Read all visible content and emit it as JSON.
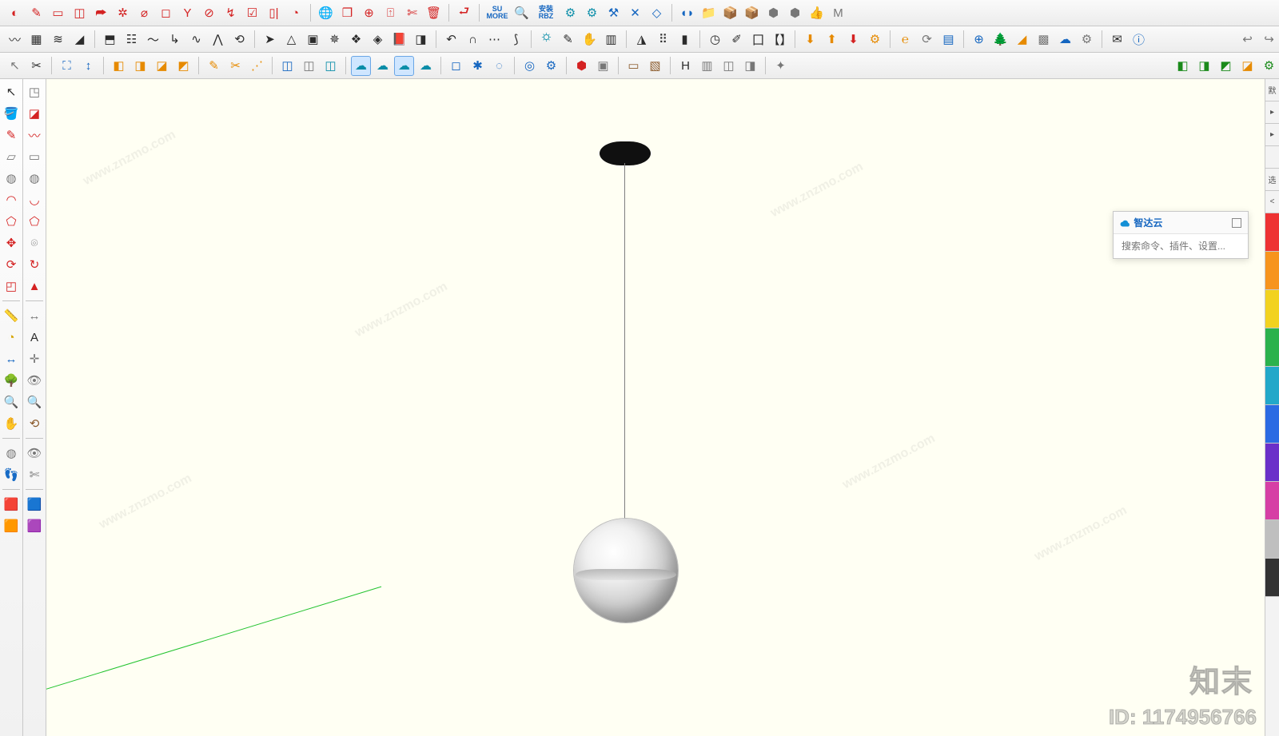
{
  "app": "SketchUp",
  "float_panel": {
    "title": "智达云",
    "search_placeholder": "搜索命令、插件、设置..."
  },
  "watermark": {
    "brand": "知末",
    "url": "www.znzmo.com",
    "id_label": "ID: 1174956766"
  },
  "toolbar_rows": [
    [
      {
        "n": "sweep-icon",
        "g": "◐",
        "c": "red"
      },
      {
        "n": "edit-icon",
        "g": "✎",
        "c": "red"
      },
      {
        "n": "window-icon",
        "g": "▭",
        "c": "red"
      },
      {
        "n": "rotate-box-icon",
        "g": "◫",
        "c": "red"
      },
      {
        "n": "export-icon",
        "g": "⮫",
        "c": "red"
      },
      {
        "n": "gear-wheel-icon",
        "g": "✲",
        "c": "red"
      },
      {
        "n": "cylinder-icon",
        "g": "⌀",
        "c": "red"
      },
      {
        "n": "cube-icon",
        "g": "◻",
        "c": "red"
      },
      {
        "n": "wine-icon",
        "g": "Y",
        "c": "red"
      },
      {
        "n": "cancel-icon",
        "g": "⊘",
        "c": "red"
      },
      {
        "n": "path-icon",
        "g": "↯",
        "c": "red"
      },
      {
        "n": "check-icon",
        "g": "☑",
        "c": "red"
      },
      {
        "n": "bar-bracket-icon",
        "g": "▯|",
        "c": "red"
      },
      {
        "n": "lasso-icon",
        "g": "◔",
        "c": "red"
      },
      {
        "sep": true
      },
      {
        "n": "globe-wire-icon",
        "g": "🌐",
        "c": "red"
      },
      {
        "n": "cube3d-icon",
        "g": "❒",
        "c": "red"
      },
      {
        "n": "target-icon",
        "g": "⊕",
        "c": "red"
      },
      {
        "n": "arrow-up-box-icon",
        "g": "⍐",
        "c": "red"
      },
      {
        "n": "cut-alt-icon",
        "g": "✄",
        "c": "red"
      },
      {
        "n": "trash-icon",
        "g": "🗑",
        "c": "red"
      },
      {
        "sep": true
      },
      {
        "n": "enter-icon",
        "g": "⮐",
        "c": "red"
      },
      {
        "sep": true
      },
      {
        "n": "su-more-text",
        "text": "SU\nMORE"
      },
      {
        "n": "search-icon",
        "g": "🔍",
        "c": "blue"
      },
      {
        "n": "install-rbz-text",
        "text": "安装\nRBZ"
      },
      {
        "n": "gear1-icon",
        "g": "⚙",
        "c": "teal"
      },
      {
        "n": "gear2-icon",
        "g": "⚙",
        "c": "teal"
      },
      {
        "n": "tools-icon",
        "g": "⚒",
        "c": "blue"
      },
      {
        "n": "tools2-icon",
        "g": "✕",
        "c": "blue"
      },
      {
        "n": "transform-icon",
        "g": "◇",
        "c": "blue"
      },
      {
        "sep": true
      },
      {
        "n": "toggle-icon",
        "g": "◖◗",
        "c": "blue"
      },
      {
        "n": "folder-icon",
        "g": "📁",
        "c": "blue"
      },
      {
        "n": "package1-icon",
        "g": "📦",
        "c": "gray"
      },
      {
        "n": "package2-icon",
        "g": "📦",
        "c": "gray"
      },
      {
        "n": "package3-icon",
        "g": "⬢",
        "c": "gray"
      },
      {
        "n": "package4-icon",
        "g": "⬢",
        "c": "gray"
      },
      {
        "n": "thumbs-icon",
        "g": "👍",
        "c": "gray"
      },
      {
        "n": "m-icon",
        "g": "M",
        "c": "gray"
      }
    ],
    [
      {
        "n": "curve-tool-icon",
        "g": "〰",
        "c": "black"
      },
      {
        "n": "grid-icon",
        "g": "▦",
        "c": "black"
      },
      {
        "n": "layers-icon",
        "g": "≋",
        "c": "black"
      },
      {
        "n": "signal-icon",
        "g": "◢",
        "c": "black"
      },
      {
        "sep": true
      },
      {
        "n": "shape1-icon",
        "g": "⬒",
        "c": "black"
      },
      {
        "n": "shape2-icon",
        "g": "☷",
        "c": "black"
      },
      {
        "n": "curve2-icon",
        "g": "〜",
        "c": "black"
      },
      {
        "n": "anchor-icon",
        "g": "↳",
        "c": "black"
      },
      {
        "n": "wave-icon",
        "g": "∿",
        "c": "black"
      },
      {
        "n": "bracket-icon",
        "g": "⋀",
        "c": "black"
      },
      {
        "n": "outline-icon",
        "g": "⟲",
        "c": "black"
      },
      {
        "sep": true
      },
      {
        "n": "nav-arrow-icon",
        "g": "➤",
        "c": "black"
      },
      {
        "n": "topo-icon",
        "g": "△",
        "c": "black"
      },
      {
        "n": "box-icon",
        "g": "▣",
        "c": "black"
      },
      {
        "n": "spray-icon",
        "g": "✵",
        "c": "black"
      },
      {
        "n": "stack-icon",
        "g": "❖",
        "c": "black"
      },
      {
        "n": "filter-icon",
        "g": "◈",
        "c": "black"
      },
      {
        "n": "book2-icon",
        "g": "📕",
        "c": "brown"
      },
      {
        "n": "cube2-icon",
        "g": "◨",
        "c": "black"
      },
      {
        "sep": true
      },
      {
        "n": "undo-arc-icon",
        "g": "↶",
        "c": "black"
      },
      {
        "n": "dome-icon",
        "g": "∩",
        "c": "black"
      },
      {
        "n": "dots-icon",
        "g": "⋯",
        "c": "black"
      },
      {
        "n": "curve3-icon",
        "g": "⟆",
        "c": "black"
      },
      {
        "sep": true
      },
      {
        "n": "sun-gear-icon",
        "g": "🌣",
        "c": "teal"
      },
      {
        "n": "pen-icon",
        "g": "✎",
        "c": "black"
      },
      {
        "n": "hand-icon",
        "g": "✋",
        "c": "black"
      },
      {
        "n": "columns-icon",
        "g": "▥",
        "c": "black"
      },
      {
        "sep": true
      },
      {
        "n": "mirror-icon",
        "g": "◮",
        "c": "black"
      },
      {
        "n": "dotsgrid-icon",
        "g": "⠿",
        "c": "black"
      },
      {
        "n": "phone-icon",
        "g": "▮",
        "c": "black"
      },
      {
        "sep": true
      },
      {
        "n": "compass-icon",
        "g": "◷",
        "c": "black"
      },
      {
        "n": "brush-icon",
        "g": "✐",
        "c": "black"
      },
      {
        "n": "seal-icon",
        "g": "囗",
        "c": "black"
      },
      {
        "n": "bracket2-icon",
        "g": "【】",
        "c": "black"
      },
      {
        "sep": true
      },
      {
        "n": "dl1-icon",
        "g": "⬇",
        "c": "orange"
      },
      {
        "n": "dl2-icon",
        "g": "⬆",
        "c": "orange"
      },
      {
        "n": "dl3-icon",
        "g": "⬇",
        "c": "red"
      },
      {
        "n": "gear3-icon",
        "g": "⚙",
        "c": "orange"
      },
      {
        "sep": true
      },
      {
        "n": "enscape-icon",
        "g": "℮",
        "c": "orange"
      },
      {
        "n": "refresh2-icon",
        "g": "⟳",
        "c": "gray"
      },
      {
        "n": "paper-icon",
        "g": "▤",
        "c": "blue"
      },
      {
        "sep": true
      },
      {
        "n": "plus-circle-icon",
        "g": "⊕",
        "c": "blue"
      },
      {
        "n": "tree-icon",
        "g": "🌲",
        "c": "green"
      },
      {
        "n": "terrain-icon",
        "g": "◢",
        "c": "orange"
      },
      {
        "n": "checker-icon",
        "g": "▩",
        "c": "gray"
      },
      {
        "n": "cloud-up-icon",
        "g": "☁",
        "c": "blue"
      },
      {
        "n": "gear4-icon",
        "g": "⚙",
        "c": "gray"
      },
      {
        "sep": true
      },
      {
        "n": "mail-icon",
        "g": "✉",
        "c": "black"
      },
      {
        "n": "info-icon",
        "g": "ⓘ",
        "c": "blue"
      },
      {
        "spacer": true
      },
      {
        "n": "undo2-icon",
        "g": "↩",
        "c": "gray"
      },
      {
        "n": "redo2-icon",
        "g": "↪",
        "c": "gray"
      }
    ],
    [
      {
        "n": "pointer-icon",
        "g": "↖",
        "c": "gray"
      },
      {
        "n": "knife-icon",
        "g": "✂",
        "c": "black"
      },
      {
        "sep": true
      },
      {
        "n": "nav1-icon",
        "g": "⛶",
        "c": "blue"
      },
      {
        "n": "nav2-icon",
        "g": "↕",
        "c": "blue"
      },
      {
        "sep": true
      },
      {
        "n": "box-orange1-icon",
        "g": "◧",
        "c": "orange"
      },
      {
        "n": "box-orange2-icon",
        "g": "◨",
        "c": "orange"
      },
      {
        "n": "box-orange3-icon",
        "g": "◪",
        "c": "orange"
      },
      {
        "n": "box-orange4-icon",
        "g": "◩",
        "c": "orange"
      },
      {
        "sep": true
      },
      {
        "n": "edit2-icon",
        "g": "✎",
        "c": "orange"
      },
      {
        "n": "scissor-icon",
        "g": "✂",
        "c": "orange"
      },
      {
        "n": "dotpath-icon",
        "g": "⋰",
        "c": "orange"
      },
      {
        "sep": true
      },
      {
        "n": "script1-icon",
        "g": "◫",
        "c": "blue"
      },
      {
        "n": "script2-icon",
        "g": "◫",
        "c": "gray"
      },
      {
        "n": "script3-icon",
        "g": "◫",
        "c": "teal"
      },
      {
        "sep": true
      },
      {
        "n": "cloud1-icon",
        "g": "☁",
        "c": "teal",
        "active": true
      },
      {
        "n": "cloud2-icon",
        "g": "☁",
        "c": "teal"
      },
      {
        "n": "cloud3-icon",
        "g": "☁",
        "c": "teal",
        "active": true
      },
      {
        "n": "cloud4-icon",
        "g": "☁",
        "c": "teal"
      },
      {
        "sep": true
      },
      {
        "n": "collab-icon",
        "g": "◻",
        "c": "blue"
      },
      {
        "n": "nodes-icon",
        "g": "✱",
        "c": "blue"
      },
      {
        "n": "nodes2-icon",
        "g": "◌",
        "c": "blue"
      },
      {
        "sep": true
      },
      {
        "n": "target2-icon",
        "g": "◎",
        "c": "blue"
      },
      {
        "n": "gear5-icon",
        "g": "⚙",
        "c": "blue"
      },
      {
        "sep": true
      },
      {
        "n": "block-red-icon",
        "g": "⬢",
        "c": "red"
      },
      {
        "n": "block-icon",
        "g": "▣",
        "c": "gray"
      },
      {
        "sep": true
      },
      {
        "n": "card1-icon",
        "g": "▭",
        "c": "brown"
      },
      {
        "n": "card2-icon",
        "g": "▧",
        "c": "brown"
      },
      {
        "sep": true
      },
      {
        "n": "h-icon",
        "g": "H",
        "c": "black"
      },
      {
        "n": "persp-icon",
        "g": "▥",
        "c": "gray"
      },
      {
        "n": "persp2-icon",
        "g": "◫",
        "c": "gray"
      },
      {
        "n": "persp3-icon",
        "g": "◨",
        "c": "gray"
      },
      {
        "sep": true
      },
      {
        "n": "effect1-icon",
        "g": "✦",
        "c": "gray"
      },
      {
        "spacer": true
      },
      {
        "n": "mat1-icon",
        "g": "◧",
        "c": "green"
      },
      {
        "n": "mat2-icon",
        "g": "◨",
        "c": "green"
      },
      {
        "n": "mat3-icon",
        "g": "◩",
        "c": "green"
      },
      {
        "n": "mat4-icon",
        "g": "◪",
        "c": "orange"
      },
      {
        "n": "matgear-icon",
        "g": "⚙",
        "c": "green"
      }
    ]
  ],
  "left_cols": [
    [
      {
        "n": "select-tool-icon",
        "g": "↖",
        "c": "black"
      },
      {
        "n": "paint-bucket-icon",
        "g": "🪣",
        "c": "orange"
      },
      {
        "n": "line-tool-icon",
        "g": "✎",
        "c": "red"
      },
      {
        "n": "rect-tool-icon",
        "g": "▱",
        "c": "gray"
      },
      {
        "n": "circle-tool-icon",
        "g": "◍",
        "c": "gray"
      },
      {
        "n": "arc-tool-icon",
        "g": "◠",
        "c": "red"
      },
      {
        "n": "polygon-tool-icon",
        "g": "⬠",
        "c": "red"
      },
      {
        "n": "move-tool-icon",
        "g": "✥",
        "c": "red"
      },
      {
        "n": "rotate-tool-icon",
        "g": "⟳",
        "c": "red"
      },
      {
        "n": "scale-tool-icon",
        "g": "◰",
        "c": "red"
      },
      {
        "hsep": true
      },
      {
        "n": "tape-tool-icon",
        "g": "📏",
        "c": "yellow"
      },
      {
        "n": "protractor-icon",
        "g": "◔",
        "c": "yellow"
      },
      {
        "n": "axes-tool-icon",
        "g": "↔",
        "c": "blue"
      },
      {
        "n": "tree3d-icon",
        "g": "🌳",
        "c": "green"
      },
      {
        "n": "orbit-tool-icon",
        "g": "🔍",
        "c": "blue"
      },
      {
        "n": "pan-tool-icon",
        "g": "✋",
        "c": "brown"
      },
      {
        "hsep": true
      },
      {
        "n": "section-tool-icon",
        "g": "◍",
        "c": "gray"
      },
      {
        "n": "walk-tool-icon",
        "g": "👣",
        "c": "black"
      },
      {
        "hsep": true
      },
      {
        "n": "component-icon",
        "g": "🟥",
        "c": "red"
      },
      {
        "n": "component2-icon",
        "g": "🟧",
        "c": "red"
      }
    ],
    [
      {
        "n": "cube-alt-icon",
        "g": "◳",
        "c": "gray"
      },
      {
        "n": "eraser-tool-icon",
        "g": "◪",
        "c": "red"
      },
      {
        "n": "freehand-icon",
        "g": "〰",
        "c": "red"
      },
      {
        "n": "rect2-icon",
        "g": "▭",
        "c": "gray"
      },
      {
        "n": "circle2-icon",
        "g": "◍",
        "c": "gray"
      },
      {
        "n": "arc2-icon",
        "g": "◡",
        "c": "red"
      },
      {
        "n": "poly2-icon",
        "g": "⬠",
        "c": "red"
      },
      {
        "n": "offset-tool-icon",
        "g": "⌾",
        "c": "gray"
      },
      {
        "n": "followme-icon",
        "g": "↻",
        "c": "red"
      },
      {
        "n": "pushpull-icon",
        "g": "▲",
        "c": "red"
      },
      {
        "hsep": true
      },
      {
        "n": "dimension-icon",
        "g": "↔",
        "c": "gray"
      },
      {
        "n": "text-label-icon",
        "g": "A",
        "c": "black"
      },
      {
        "n": "position-icon",
        "g": "✛",
        "c": "gray"
      },
      {
        "n": "look-icon",
        "g": "👁",
        "c": "gray"
      },
      {
        "n": "zoom-ext-icon",
        "g": "🔍",
        "c": "blue"
      },
      {
        "n": "prevview-icon",
        "g": "⟲",
        "c": "brown"
      },
      {
        "hsep": true
      },
      {
        "n": "eye-tool-icon",
        "g": "👁",
        "c": "gray"
      },
      {
        "n": "cut2-icon",
        "g": "✄",
        "c": "gray"
      },
      {
        "hsep": true
      },
      {
        "n": "component3-icon",
        "g": "🟦",
        "c": "red"
      },
      {
        "n": "component4-icon",
        "g": "🟪",
        "c": "red"
      }
    ]
  ],
  "right_rail": {
    "tabs": [
      "默",
      "▸",
      "▸",
      "",
      "选",
      "<"
    ],
    "colors": [
      "c-red",
      "c-orange",
      "c-yellow",
      "c-green",
      "c-cyan",
      "c-blue",
      "c-purple",
      "c-pink",
      "c-gray",
      "c-black"
    ]
  }
}
